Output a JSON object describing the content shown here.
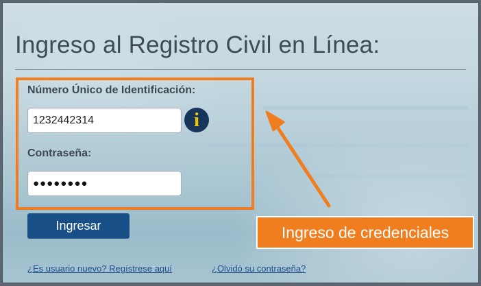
{
  "page": {
    "title": "Ingreso al Registro Civil en Línea:"
  },
  "form": {
    "nui_label": "Número Único de Identificación:",
    "nui_value": "1232442314",
    "password_label": "Contraseña:",
    "password_value": "●●●●●●●●",
    "info_icon_glyph": "i",
    "submit_label": "Ingresar"
  },
  "links": {
    "register": "¿Es usuario nuevo? Regístrese aquí",
    "forgot_password": "¿Olvidó su contraseña?"
  },
  "annotation": {
    "callout_text": "Ingreso de credenciales",
    "color": "#f07d1e"
  },
  "colors": {
    "title_text": "#3f4b55",
    "button_bg": "#174f86",
    "info_icon_bg": "#17345a",
    "info_icon_fg": "#f0c400",
    "link": "#1f4f8c"
  }
}
